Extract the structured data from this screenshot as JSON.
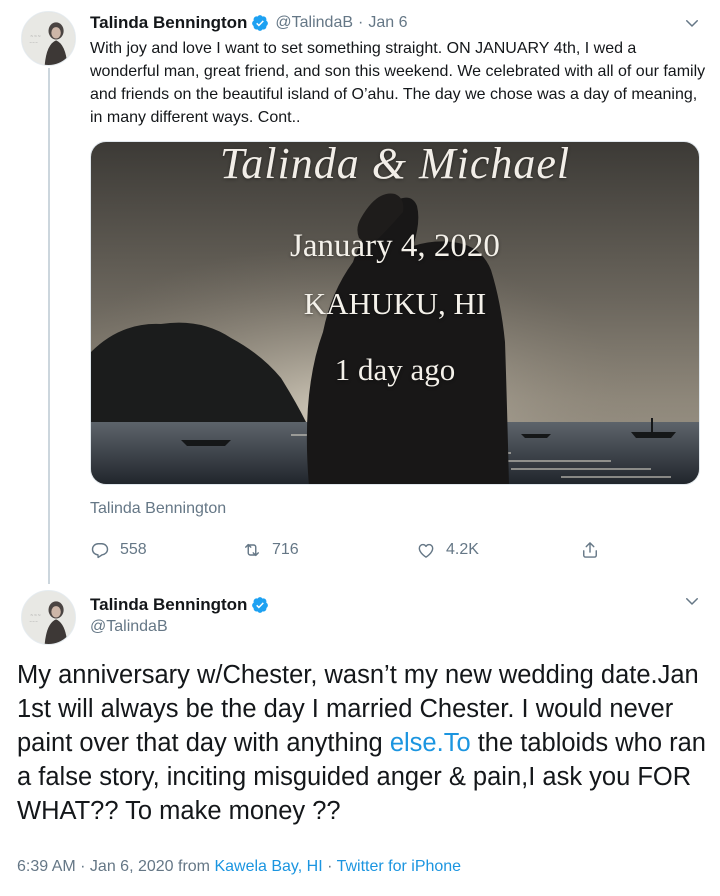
{
  "tweet1": {
    "name": "Talinda Bennington",
    "handle": "@TalindaB",
    "separator": "·",
    "date": "Jan 6",
    "text": "With joy and love I want to set something straight. ON JANUARY 4th, I wed a wonderful man, great friend, and son this weekend. We celebrated with all of our family and friends on the beautiful island of O’ahu. The day we chose was a day of meaning, in many different ways. Cont..",
    "image": {
      "script_text": "Talinda & Michael",
      "date_text": "January 4, 2020",
      "place_text": "KAHUKU, HI",
      "ago_text": "1 day ago"
    },
    "caption": "Talinda Bennington",
    "replies": "558",
    "retweets": "716",
    "likes": "4.2K"
  },
  "tweet2": {
    "name": "Talinda Bennington",
    "handle": "@TalindaB",
    "text_part1": "My anniversary w/Chester, wasn’t my new wedding date.Jan 1st will always be the day I married Chester. I would never paint over that day with anything ",
    "link_text": "else.To",
    "text_part2": " the tabloids who ran a false story, inciting misguided anger & pain,I ask you FOR WHAT?? To make money ??",
    "time": "6:39 AM · Jan 6, 2020 from ",
    "location": "Kawela Bay, HI",
    "sep": " · ",
    "client": "Twitter for iPhone"
  },
  "colors": {
    "link": "#1b95e0",
    "verified": "#1da1f2",
    "secondary_text": "#657786",
    "thread_line": "#ccd6dd"
  },
  "icons": [
    "verified-badge-icon",
    "chevron-down-icon",
    "reply-icon",
    "retweet-icon",
    "like-icon",
    "share-icon"
  ]
}
